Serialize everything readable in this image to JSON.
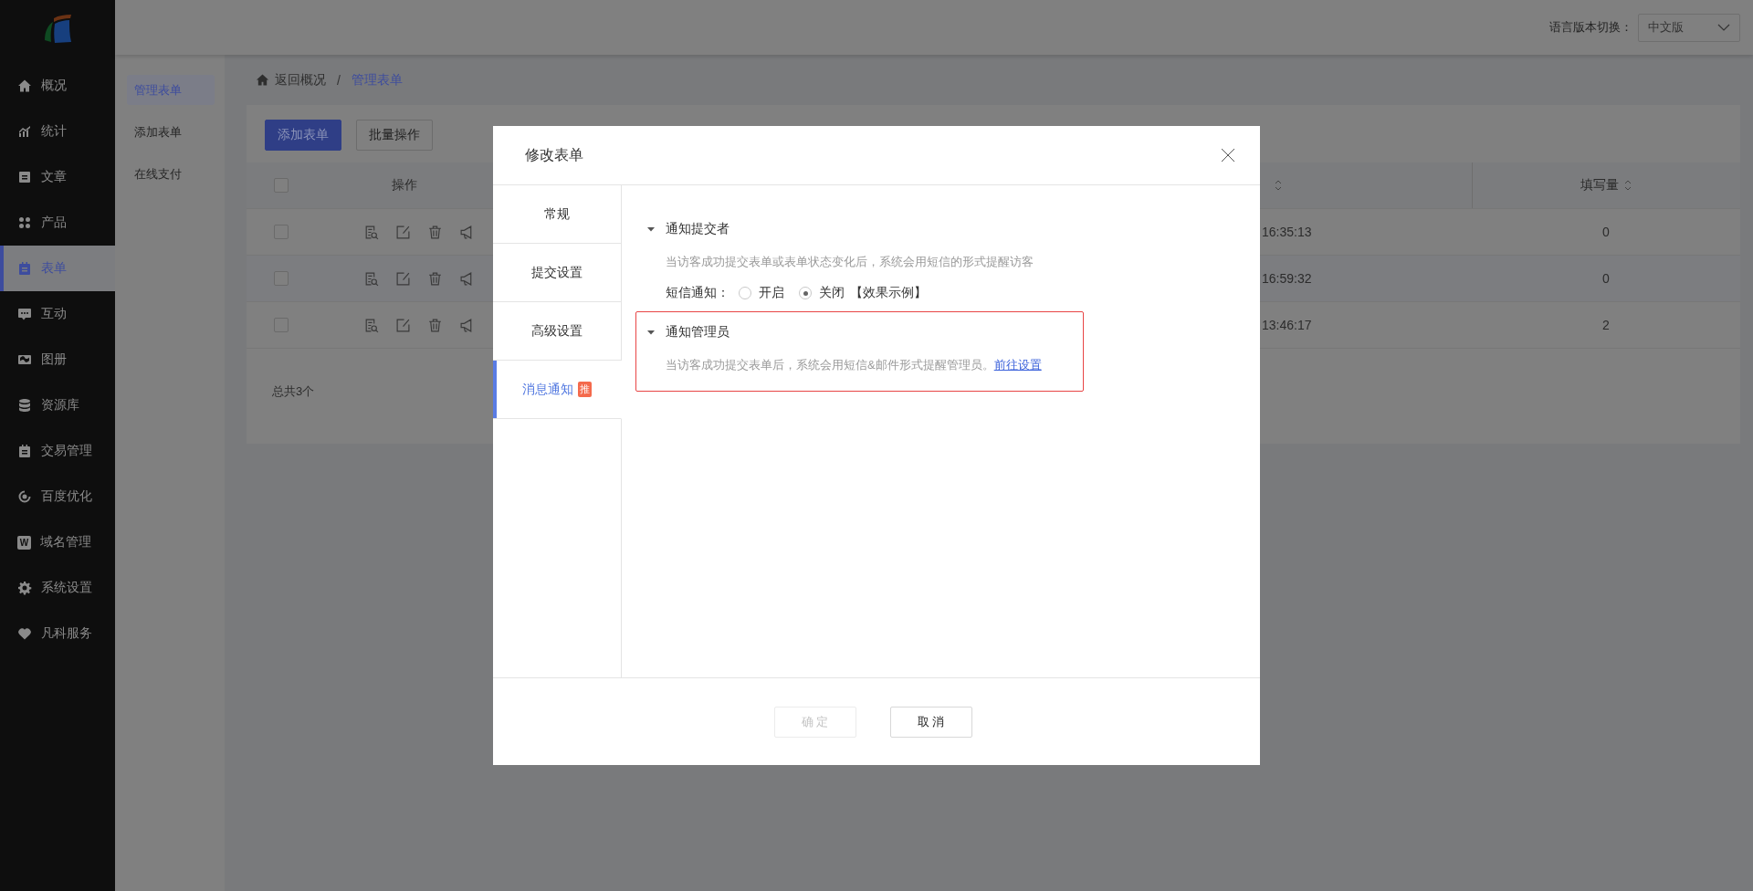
{
  "sidebar": {
    "items": [
      {
        "label": "概况",
        "selected": false
      },
      {
        "label": "统计",
        "selected": false
      },
      {
        "label": "文章",
        "selected": false
      },
      {
        "label": "产品",
        "selected": false
      },
      {
        "label": "表单",
        "selected": true
      },
      {
        "label": "互动",
        "selected": false
      },
      {
        "label": "图册",
        "selected": false
      },
      {
        "label": "资源库",
        "selected": false
      },
      {
        "label": "交易管理",
        "selected": false
      },
      {
        "label": "百度优化",
        "selected": false
      },
      {
        "label": "域名管理",
        "selected": false,
        "icon_letter": "W"
      },
      {
        "label": "系统设置",
        "selected": false
      },
      {
        "label": "凡科服务",
        "selected": false
      }
    ]
  },
  "header": {
    "language_label": "语言版本切换：",
    "language_select": {
      "value": "中文版"
    }
  },
  "subnav": {
    "items": [
      {
        "label": "管理表单",
        "selected": true
      },
      {
        "label": "添加表单",
        "selected": false
      },
      {
        "label": "在线支付",
        "selected": false
      }
    ]
  },
  "breadcrumb": {
    "items": [
      {
        "label": "返回概况",
        "current": false
      },
      {
        "label": "管理表单",
        "current": true
      }
    ],
    "separator": "/"
  },
  "toolbar": {
    "buttons": [
      {
        "label": "添加表单",
        "kind": "primary"
      },
      {
        "label": "批量操作",
        "kind": "default"
      }
    ]
  },
  "table": {
    "header_checked": false,
    "columns": {
      "actions": "操作",
      "count": "填写量"
    },
    "rows": [
      {
        "checked": false,
        "time": "16:35:13",
        "count": "0"
      },
      {
        "checked": false,
        "time": "16:59:32",
        "count": "0"
      },
      {
        "checked": false,
        "time": "13:46:17",
        "count": "2"
      }
    ],
    "total": "总共3个"
  },
  "modal": {
    "title": "修改表单",
    "tabs": [
      {
        "label": "常规",
        "selected": false
      },
      {
        "label": "提交设置",
        "selected": false
      },
      {
        "label": "高级设置",
        "selected": false
      },
      {
        "label": "消息通知",
        "selected": true,
        "badge": "推"
      }
    ],
    "sections": [
      {
        "title": "通知提交者",
        "expanded": true,
        "highlighted": false,
        "description": "当访客成功提交表单或表单状态变化后，系统会用短信的形式提醒访客",
        "sms": {
          "label": "短信通知：",
          "options": [
            {
              "label": "开启",
              "selected": false
            },
            {
              "label": "关闭",
              "selected": true
            }
          ],
          "example": "【效果示例】"
        }
      },
      {
        "title": "通知管理员",
        "expanded": true,
        "highlighted": true,
        "description": "当访客成功提交表单后，系统会用短信&邮件形式提醒管理员。",
        "link": "前往设置"
      }
    ],
    "buttons": [
      {
        "label": "确 定",
        "disabled": true
      },
      {
        "label": "取 消",
        "disabled": false
      }
    ]
  }
}
